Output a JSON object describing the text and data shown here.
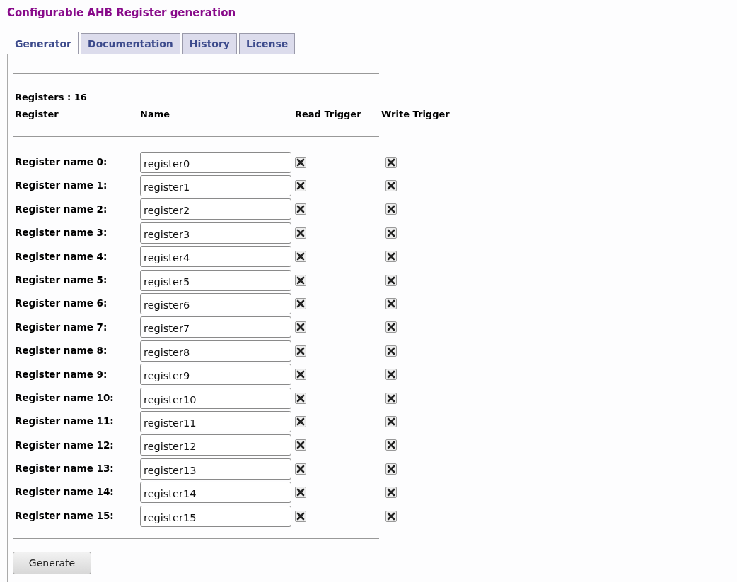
{
  "title": "Configurable AHB Register generation",
  "tabs": [
    {
      "label": "Generator",
      "selected": true
    },
    {
      "label": "Documentation",
      "selected": false
    },
    {
      "label": "History",
      "selected": false
    },
    {
      "label": "License",
      "selected": false
    }
  ],
  "register_count": "Registers : 16",
  "columns": [
    "Register",
    "Name",
    "Read Trigger",
    "Write Trigger"
  ],
  "registers": [
    {
      "label": "Register name 0:",
      "value": "register0",
      "read_trigger": true,
      "write_trigger": true
    },
    {
      "label": "Register name 1:",
      "value": "register1",
      "read_trigger": true,
      "write_trigger": true
    },
    {
      "label": "Register name 2:",
      "value": "register2",
      "read_trigger": true,
      "write_trigger": true
    },
    {
      "label": "Register name 3:",
      "value": "register3",
      "read_trigger": true,
      "write_trigger": true
    },
    {
      "label": "Register name 4:",
      "value": "register4",
      "read_trigger": true,
      "write_trigger": true
    },
    {
      "label": "Register name 5:",
      "value": "register5",
      "read_trigger": true,
      "write_trigger": true
    },
    {
      "label": "Register name 6:",
      "value": "register6",
      "read_trigger": true,
      "write_trigger": true
    },
    {
      "label": "Register name 7:",
      "value": "register7",
      "read_trigger": true,
      "write_trigger": true
    },
    {
      "label": "Register name 8:",
      "value": "register8",
      "read_trigger": true,
      "write_trigger": true
    },
    {
      "label": "Register name 9:",
      "value": "register9",
      "read_trigger": true,
      "write_trigger": true
    },
    {
      "label": "Register name 10:",
      "value": "register10",
      "read_trigger": true,
      "write_trigger": true
    },
    {
      "label": "Register name 11:",
      "value": "register11",
      "read_trigger": true,
      "write_trigger": true
    },
    {
      "label": "Register name 12:",
      "value": "register12",
      "read_trigger": true,
      "write_trigger": true
    },
    {
      "label": "Register name 13:",
      "value": "register13",
      "read_trigger": true,
      "write_trigger": true
    },
    {
      "label": "Register name 14:",
      "value": "register14",
      "read_trigger": true,
      "write_trigger": true
    },
    {
      "label": "Register name 15:",
      "value": "register15",
      "read_trigger": true,
      "write_trigger": true
    }
  ],
  "button": "Generate"
}
